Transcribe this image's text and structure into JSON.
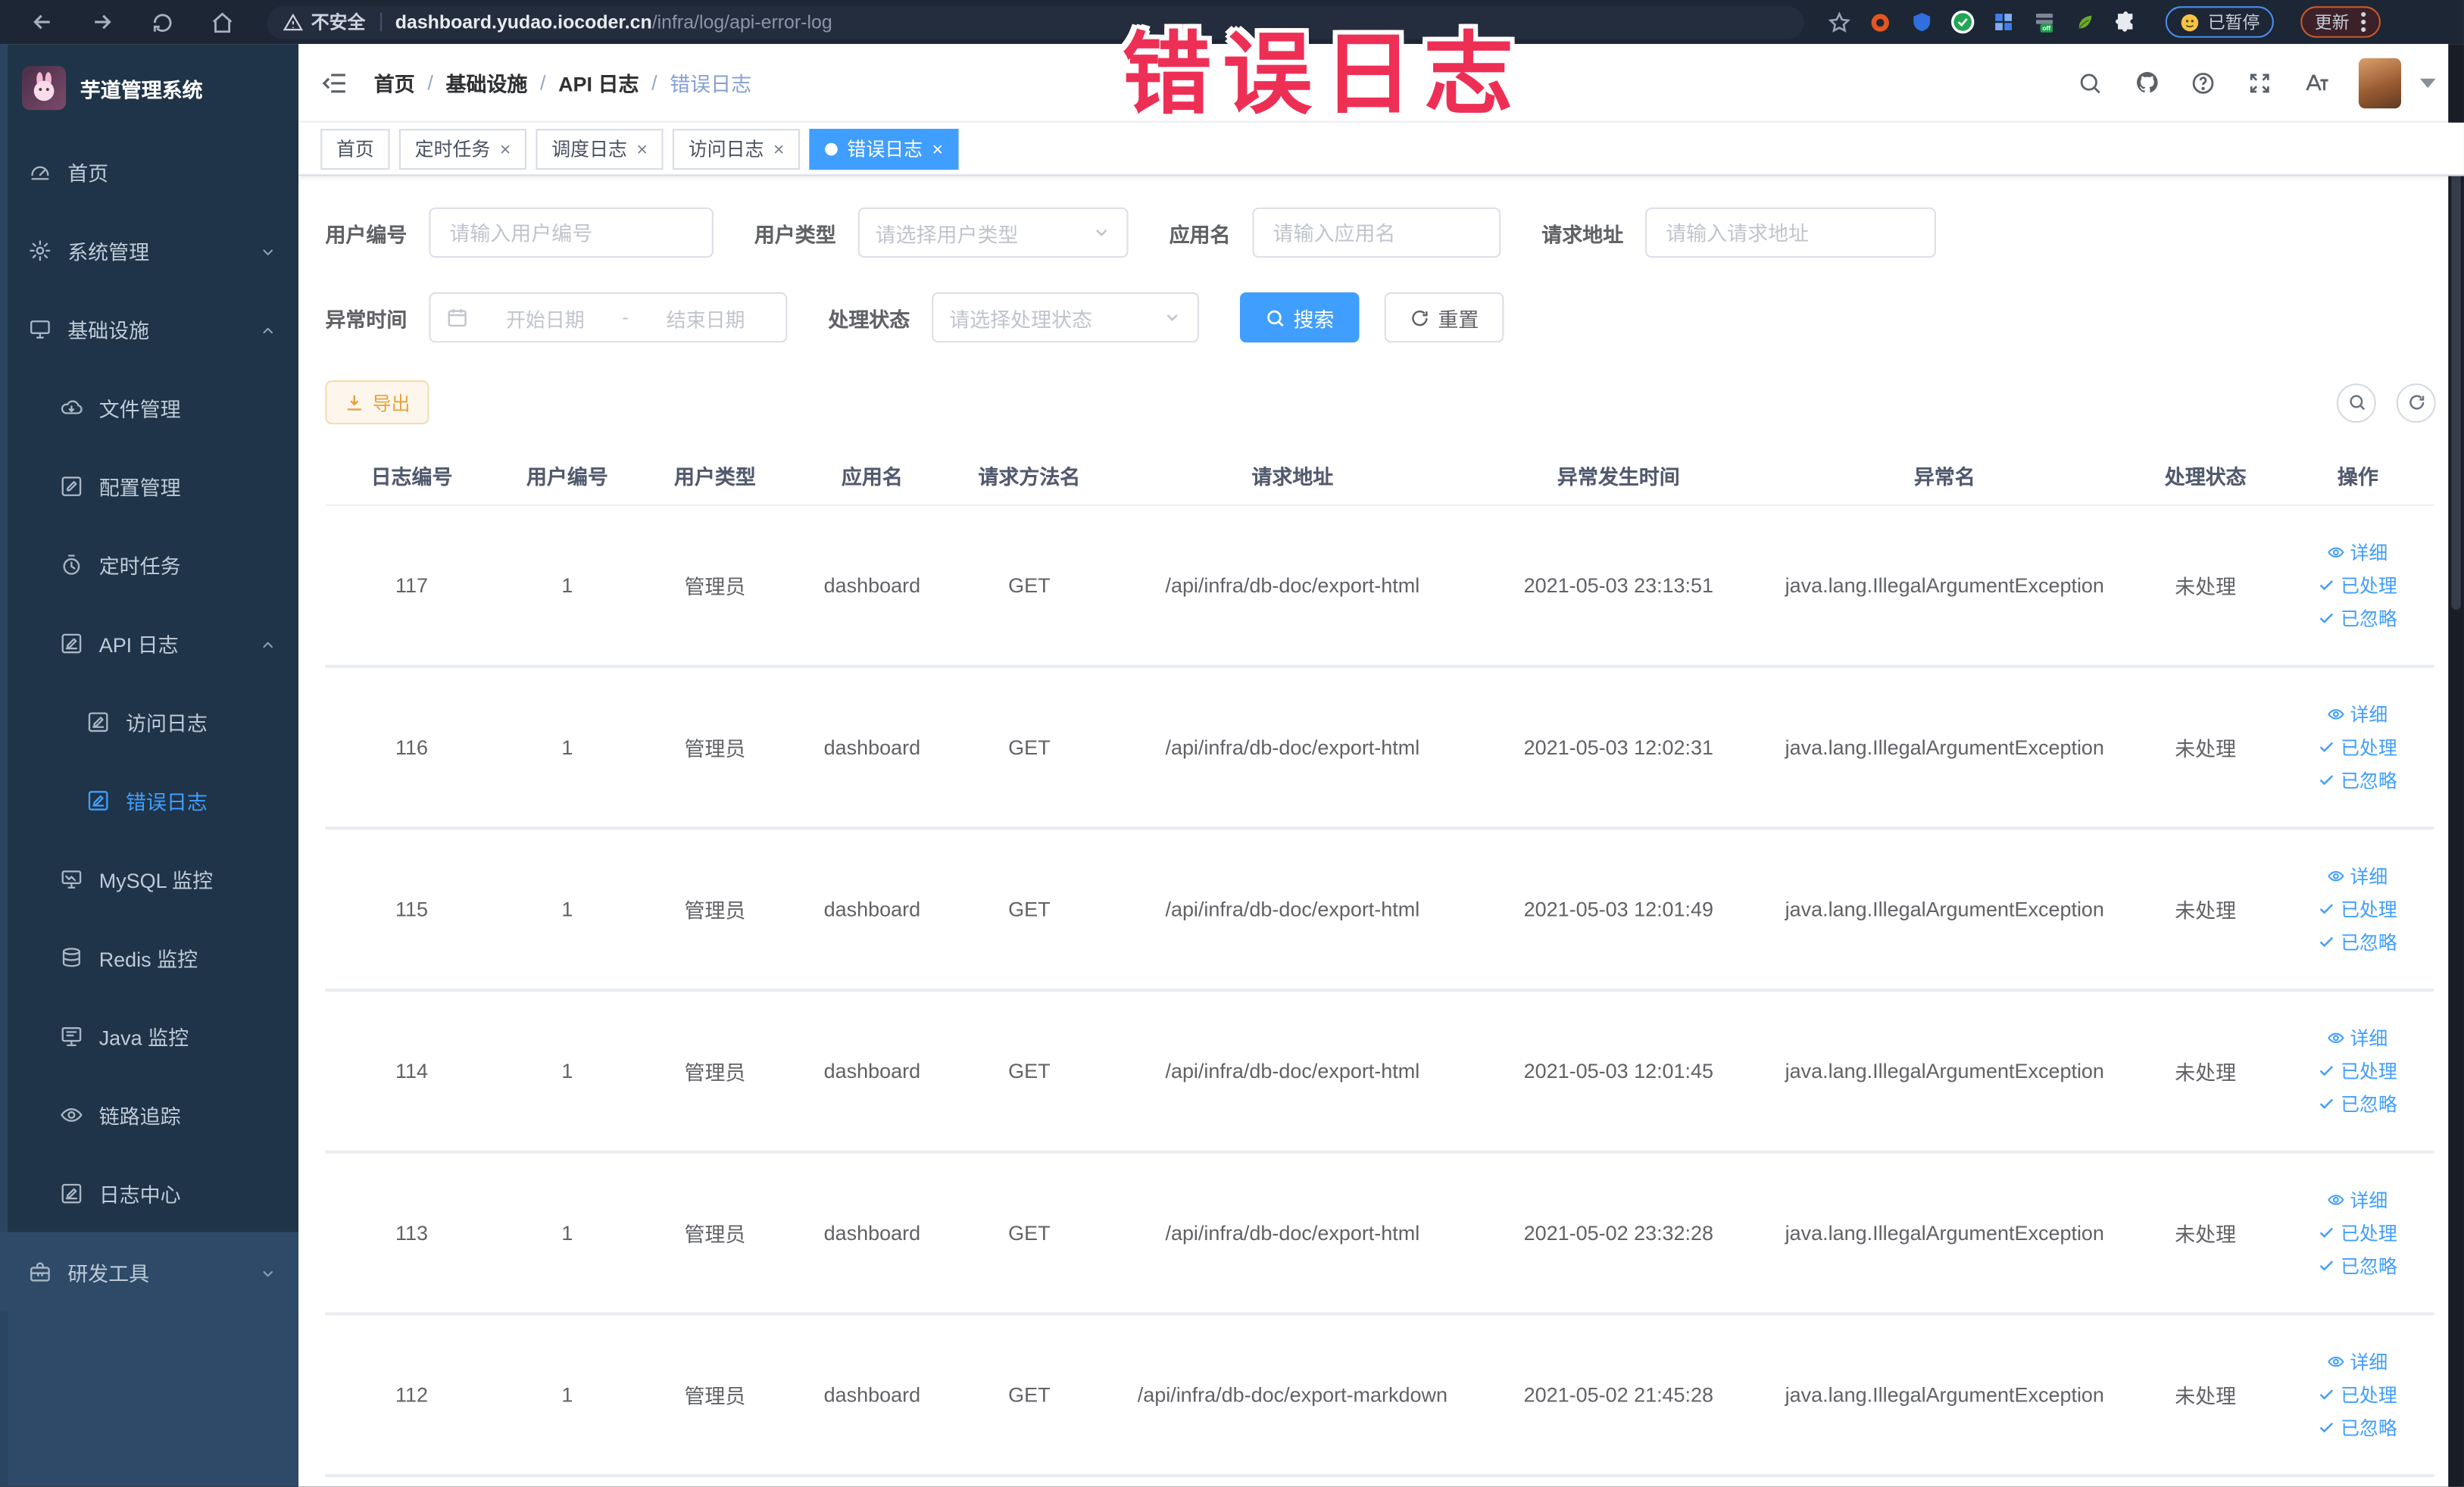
{
  "browser": {
    "security_label": "不安全",
    "url_domain": "dashboard.yudao.iocoder.cn",
    "url_path": "/infra/log/api-error-log",
    "paused_label": "已暂停",
    "update_label": "更新",
    "extensions": [
      {
        "id": "ublock",
        "color": "#e2571f"
      },
      {
        "id": "shield",
        "color": "#2f6fe0"
      },
      {
        "id": "green-check",
        "color": "#21a657"
      },
      {
        "id": "grid",
        "color": "#3f7fe8"
      },
      {
        "id": "off-badge",
        "color": "#1fa04d"
      },
      {
        "id": "leaf",
        "color": "#6cab2e"
      },
      {
        "id": "puzzle",
        "color": "#e8eaef"
      }
    ]
  },
  "annotation": {
    "text": "错误日志",
    "color": "#ee2f55"
  },
  "sidebar": {
    "app_title": "芋道管理系统",
    "items": [
      {
        "id": "home",
        "label": "首页",
        "icon": "gauge",
        "level": 0
      },
      {
        "id": "system",
        "label": "系统管理",
        "icon": "gear",
        "level": 0,
        "chevron": "down"
      },
      {
        "id": "infra",
        "label": "基础设施",
        "icon": "monitor",
        "level": 0,
        "chevron": "up"
      },
      {
        "id": "file",
        "label": "文件管理",
        "icon": "cloud",
        "level": 1
      },
      {
        "id": "config",
        "label": "配置管理",
        "icon": "pen",
        "level": 1
      },
      {
        "id": "job",
        "label": "定时任务",
        "icon": "timer",
        "level": 1
      },
      {
        "id": "api-log",
        "label": "API 日志",
        "icon": "logedit",
        "level": 1,
        "chevron": "up"
      },
      {
        "id": "access-log",
        "label": "访问日志",
        "icon": "logedit",
        "level": 2
      },
      {
        "id": "error-log",
        "label": "错误日志",
        "icon": "logedit",
        "level": 2,
        "active": true
      },
      {
        "id": "mysql",
        "label": "MySQL 监控",
        "icon": "db",
        "level": 1
      },
      {
        "id": "redis",
        "label": "Redis 监控",
        "icon": "redis",
        "level": 1
      },
      {
        "id": "java",
        "label": "Java 监控",
        "icon": "java",
        "level": 1
      },
      {
        "id": "trace",
        "label": "链路追踪",
        "icon": "eye",
        "level": 1
      },
      {
        "id": "log-center",
        "label": "日志中心",
        "icon": "logedit",
        "level": 1
      },
      {
        "id": "dev-tool",
        "label": "研发工具",
        "icon": "toolbox",
        "level": 0,
        "chevron": "down",
        "section": "light"
      }
    ]
  },
  "header": {
    "breadcrumb": [
      "首页",
      "基础设施",
      "API 日志",
      "错误日志"
    ]
  },
  "tags": [
    {
      "id": "home",
      "label": "首页"
    },
    {
      "id": "job",
      "label": "定时任务",
      "closable": true
    },
    {
      "id": "job-log",
      "label": "调度日志",
      "closable": true
    },
    {
      "id": "access-log",
      "label": "访问日志",
      "closable": true
    },
    {
      "id": "error-log",
      "label": "错误日志",
      "closable": true,
      "active": true
    }
  ],
  "filters": {
    "user_id": {
      "label": "用户编号",
      "placeholder": "请输入用户编号"
    },
    "user_type": {
      "label": "用户类型",
      "placeholder": "请选择用户类型"
    },
    "app_name": {
      "label": "应用名",
      "placeholder": "请输入应用名"
    },
    "request_url": {
      "label": "请求地址",
      "placeholder": "请输入请求地址"
    },
    "exception_time": {
      "label": "异常时间",
      "start_placeholder": "开始日期",
      "separator": "-",
      "end_placeholder": "结束日期"
    },
    "process_status": {
      "label": "处理状态",
      "placeholder": "请选择处理状态"
    },
    "search_label": "搜索",
    "reset_label": "重置"
  },
  "toolbar": {
    "export_label": "导出"
  },
  "table": {
    "columns": [
      {
        "key": "id",
        "label": "日志编号"
      },
      {
        "key": "userId",
        "label": "用户编号"
      },
      {
        "key": "userType",
        "label": "用户类型"
      },
      {
        "key": "appName",
        "label": "应用名"
      },
      {
        "key": "method",
        "label": "请求方法名"
      },
      {
        "key": "url",
        "label": "请求地址"
      },
      {
        "key": "time",
        "label": "异常发生时间"
      },
      {
        "key": "exception",
        "label": "异常名"
      },
      {
        "key": "status",
        "label": "处理状态"
      },
      {
        "key": "ops",
        "label": "操作"
      }
    ],
    "action_labels": [
      {
        "id": "detail",
        "label": "详细",
        "icon": "eye"
      },
      {
        "id": "processed",
        "label": "已处理",
        "icon": "check"
      },
      {
        "id": "ignored",
        "label": "已忽略",
        "icon": "check"
      }
    ],
    "rows": [
      {
        "id": "117",
        "userId": "1",
        "userType": "管理员",
        "appName": "dashboard",
        "method": "GET",
        "url": "/api/infra/db-doc/export-html",
        "time": "2021-05-03 23:13:51",
        "exception": "java.lang.IllegalArgumentException",
        "status": "未处理"
      },
      {
        "id": "116",
        "userId": "1",
        "userType": "管理员",
        "appName": "dashboard",
        "method": "GET",
        "url": "/api/infra/db-doc/export-html",
        "time": "2021-05-03 12:02:31",
        "exception": "java.lang.IllegalArgumentException",
        "status": "未处理"
      },
      {
        "id": "115",
        "userId": "1",
        "userType": "管理员",
        "appName": "dashboard",
        "method": "GET",
        "url": "/api/infra/db-doc/export-html",
        "time": "2021-05-03 12:01:49",
        "exception": "java.lang.IllegalArgumentException",
        "status": "未处理"
      },
      {
        "id": "114",
        "userId": "1",
        "userType": "管理员",
        "appName": "dashboard",
        "method": "GET",
        "url": "/api/infra/db-doc/export-html",
        "time": "2021-05-03 12:01:45",
        "exception": "java.lang.IllegalArgumentException",
        "status": "未处理"
      },
      {
        "id": "113",
        "userId": "1",
        "userType": "管理员",
        "appName": "dashboard",
        "method": "GET",
        "url": "/api/infra/db-doc/export-html",
        "time": "2021-05-02 23:32:28",
        "exception": "java.lang.IllegalArgumentException",
        "status": "未处理"
      },
      {
        "id": "112",
        "userId": "1",
        "userType": "管理员",
        "appName": "dashboard",
        "method": "GET",
        "url": "/api/infra/db-doc/export-markdown",
        "time": "2021-05-02 21:45:28",
        "exception": "java.lang.IllegalArgumentException",
        "status": "未处理"
      }
    ]
  }
}
